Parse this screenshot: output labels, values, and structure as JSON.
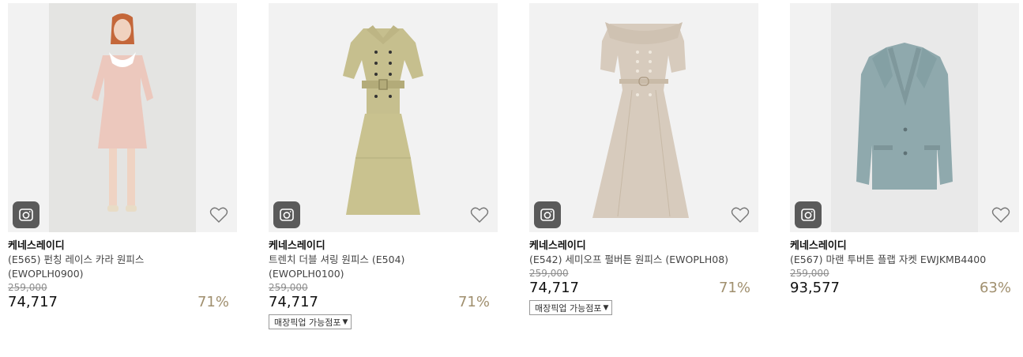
{
  "products": [
    {
      "brand": "케네스레이디",
      "title_line1": "(E565) 펀칭 레이스 카라 원피스",
      "title_line2": "(EWOPLH0900)",
      "original_price": "259,000",
      "price": "74,717",
      "discount": "71%",
      "pickup_label": ""
    },
    {
      "brand": "케네스레이디",
      "title_line1": "트렌치 더블 셔링 원피스 (E504)",
      "title_line2": "(EWOPLH0100)",
      "original_price": "259,000",
      "price": "74,717",
      "discount": "71%",
      "pickup_label": "매장픽업 가능점포"
    },
    {
      "brand": "케네스레이디",
      "title_line1": "(E542) 세미오프 펄버튼 원피스 (EWOPLH08)",
      "title_line2": "",
      "original_price": "259,000",
      "price": "74,717",
      "discount": "71%",
      "pickup_label": "매장픽업 가능점포"
    },
    {
      "brand": "케네스레이디",
      "title_line1": "(E567) 마랜 투버튼 플랩 자켓 EWJKMB4400",
      "title_line2": "",
      "original_price": "259,000",
      "price": "93,577",
      "discount": "63%",
      "pickup_label": ""
    }
  ],
  "icons": {
    "camera": "camera-icon",
    "wishlist": "heart-outline-icon",
    "dropdown": "caret-down-icon"
  },
  "colors": {
    "discount": "#a08f6e",
    "icon_button": "#5a5a5a"
  }
}
